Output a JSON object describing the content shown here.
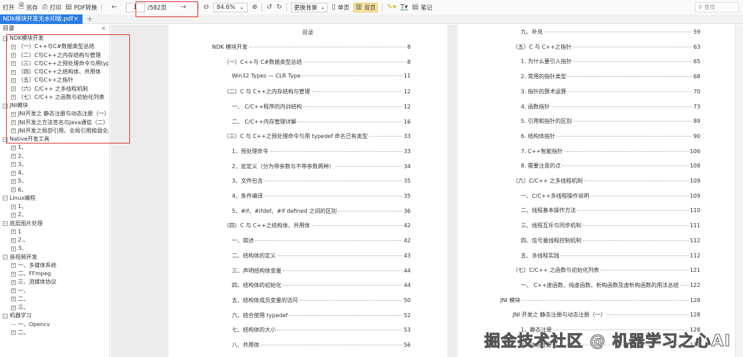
{
  "toolbar": {
    "open": "打开",
    "save_as": "另存",
    "print": "打印",
    "pdf_convert": "PDF转换",
    "page_current": "1",
    "page_total": "/582页",
    "zoom": "84.6%",
    "bg": "更换背景",
    "single": "单页",
    "double": "双页",
    "note": "笔记",
    "search_placeholder": "查找"
  },
  "tab": {
    "name": "NDk模块开发无水印版.pdf",
    "close": "×",
    "add": "+"
  },
  "sidebar": {
    "title": "目录",
    "close": "×",
    "tree": [
      {
        "l": 0,
        "t": "NDK模块开发"
      },
      {
        "l": 1,
        "t": "（一）C++与C#数据类型总结"
      },
      {
        "l": 1,
        "t": "（二）C与C++之内存结构与管理"
      },
      {
        "l": 1,
        "t": "（三）C与C++之预处理命令与用typedef"
      },
      {
        "l": 1,
        "t": "（四）C与C++之结构体、共用体"
      },
      {
        "l": 1,
        "t": "（五）C与C++之指针"
      },
      {
        "l": 1,
        "t": "（六）C/C++ 之多线程机制"
      },
      {
        "l": 1,
        "t": "（七）C/C++ 之函数与初始化列表"
      },
      {
        "l": 0,
        "t": "JNI模块"
      },
      {
        "l": 1,
        "t": "JNI开发之 静态注册与动态注册（一）"
      },
      {
        "l": 1,
        "t": "JNI开发之方法签名与Java通信（二）"
      },
      {
        "l": 1,
        "t": "JNI开发之局部引用、全局引用和弱全局引"
      },
      {
        "l": 0,
        "t": "Native开发工具"
      },
      {
        "l": 1,
        "t": "1、"
      },
      {
        "l": 1,
        "t": "2、"
      },
      {
        "l": 1,
        "t": "3、"
      },
      {
        "l": 1,
        "t": "4、"
      },
      {
        "l": 1,
        "t": "5、"
      },
      {
        "l": 1,
        "t": "6、"
      },
      {
        "l": 0,
        "t": "Linux编程"
      },
      {
        "l": 1,
        "t": "1、"
      },
      {
        "l": 1,
        "t": "2、"
      },
      {
        "l": 0,
        "t": "底层图片处理"
      },
      {
        "l": 1,
        "t": "1"
      },
      {
        "l": 1,
        "t": "2.、"
      },
      {
        "l": 1,
        "t": "3、"
      },
      {
        "l": 0,
        "t": "音视频开发"
      },
      {
        "l": 1,
        "t": "一、多媒体系统"
      },
      {
        "l": 1,
        "t": "二、FFmpeg"
      },
      {
        "l": 1,
        "t": "三、流媒体协议"
      },
      {
        "l": 1,
        "t": "一、"
      },
      {
        "l": 1,
        "t": "二、"
      },
      {
        "l": 1,
        "t": "三、"
      },
      {
        "l": 0,
        "t": "机器学习"
      },
      {
        "l": 1,
        "t": "一、Opencv",
        "leaf": true
      },
      {
        "l": 1,
        "t": "二、"
      }
    ]
  },
  "page1": {
    "title": "目录",
    "entries": [
      {
        "l": 0,
        "t": "NDK 模块开发",
        "p": "8"
      },
      {
        "l": 1,
        "t": "（一）C++与 C#数据类型总结",
        "p": "8"
      },
      {
        "l": 2,
        "t": "Win32 Types — CLR Type",
        "p": "11"
      },
      {
        "l": 1,
        "t": "（二）C 与 C++之内存结构与管理",
        "p": "12"
      },
      {
        "l": 2,
        "t": "一、  C/C++程序的内训结构",
        "p": "12"
      },
      {
        "l": 2,
        "t": "二、  C/C++内存管理详解",
        "p": "16"
      },
      {
        "l": 1,
        "t": "（三）C 与 C++之预处理命令与用 typedef 命名已有类型",
        "p": "33"
      },
      {
        "l": 2,
        "t": "1、预处理命令",
        "p": "33"
      },
      {
        "l": 2,
        "t": "2、宏定义（分为带参数与不带参数两种）",
        "p": "34"
      },
      {
        "l": 2,
        "t": "3、文件包含",
        "p": "35"
      },
      {
        "l": 2,
        "t": "4、条件编译",
        "p": "35"
      },
      {
        "l": 2,
        "t": "5、#if、#ifdef、#if defined 之间的区别",
        "p": "36"
      },
      {
        "l": 1,
        "t": "（四）C 与 C++之结构体、共用体",
        "p": "42"
      },
      {
        "l": 2,
        "t": "一、简述",
        "p": "42"
      },
      {
        "l": 2,
        "t": "二、结构体的定义",
        "p": "43"
      },
      {
        "l": 2,
        "t": "三、声明结构体变量",
        "p": "44"
      },
      {
        "l": 2,
        "t": "四、结构体的初始化",
        "p": "44"
      },
      {
        "l": 2,
        "t": "五、结构体成员变量的访问",
        "p": "50"
      },
      {
        "l": 2,
        "t": "六、结合使用 typedef",
        "p": "52"
      },
      {
        "l": 2,
        "t": "七、结构体的大小",
        "p": "53"
      },
      {
        "l": 2,
        "t": "八、共用体",
        "p": "56"
      }
    ]
  },
  "page2": {
    "entries": [
      {
        "l": 2,
        "t": "九、补充",
        "p": "59"
      },
      {
        "l": 1,
        "t": "（五）C 与 C++之指针",
        "p": "63"
      },
      {
        "l": 2,
        "t": "1. 为什么要引入指针",
        "p": "65"
      },
      {
        "l": 2,
        "t": "2. 常用的指针类型",
        "p": "68"
      },
      {
        "l": 2,
        "t": "3. 指针的算术运算",
        "p": "70"
      },
      {
        "l": 2,
        "t": "4. 函数指针",
        "p": "73"
      },
      {
        "l": 2,
        "t": "5. 引用和指针的区别",
        "p": "89"
      },
      {
        "l": 2,
        "t": "6. 结构体指针",
        "p": "90"
      },
      {
        "l": 2,
        "t": "7. C++智能指针",
        "p": "106"
      },
      {
        "l": 2,
        "t": "8. 需要注意的点",
        "p": "108"
      },
      {
        "l": 1,
        "t": "（六）C/C++ 之多线程机制",
        "p": "109"
      },
      {
        "l": 2,
        "t": "一、C/C++多线程操作说明",
        "p": "109"
      },
      {
        "l": 2,
        "t": "二、线程基本操作方法",
        "p": "110"
      },
      {
        "l": 2,
        "t": "三、线程互斥与同步机制",
        "p": "111"
      },
      {
        "l": 2,
        "t": "四、信号量线程控制机制",
        "p": "112"
      },
      {
        "l": 2,
        "t": "五、多线程实践",
        "p": "112"
      },
      {
        "l": 1,
        "t": "（七）C/C++ 之函数与初始化列表",
        "p": "121"
      },
      {
        "l": 2,
        "t": "一、  C++虚函数、纯虚函数、析构函数及虚析构函数的用法总结",
        "p": "122"
      },
      {
        "l": 0,
        "t": "JNI 模块",
        "p": "128"
      },
      {
        "l": 1,
        "t": "JNI 开发之 静态注册与动态注册（一）",
        "p": "128"
      },
      {
        "l": 2,
        "t": "1、静态注册",
        "p": "128"
      },
      {
        "l": 2,
        "t": "2、动态注册",
        "p": "129"
      }
    ]
  },
  "watermark": "掘金技术社区 @ 机器学习之心AI",
  "colors": {
    "tab": "#2b7de1",
    "highlight": "#e03030"
  }
}
